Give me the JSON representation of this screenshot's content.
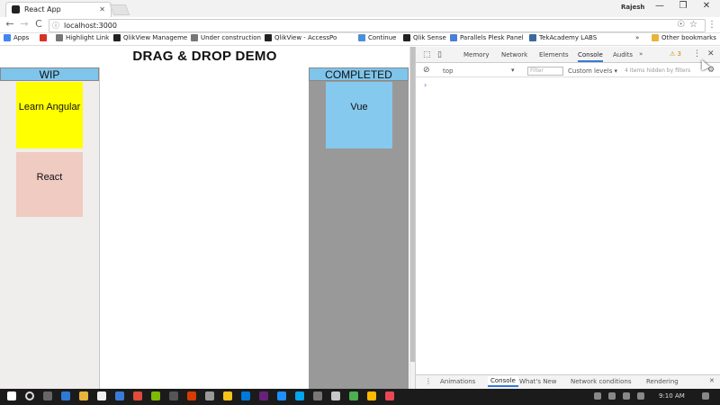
{
  "browser": {
    "tab_title": "React App",
    "user_name": "Rajesh",
    "url": "localhost:3000",
    "controls": {
      "minimize": "—",
      "maximize": "❐",
      "close": "✕"
    },
    "nav": {
      "back": "←",
      "forward": "→",
      "reload": "C"
    },
    "omnibox_icon": "ⓘ",
    "omnibox_right": {
      "zoom": "☉",
      "star": "☆",
      "menu": "⋮"
    }
  },
  "bookmarks": {
    "items": [
      {
        "label": "Apps",
        "icon": "apps-grid-icon",
        "color": "#4285f4"
      },
      {
        "label": "",
        "icon": "gmail-icon",
        "color": "#d93025"
      },
      {
        "label": "Highlight Link",
        "icon": "page-icon",
        "color": "#777777"
      },
      {
        "label": "QlikView Manageme",
        "icon": "qlik-icon",
        "color": "#222222"
      },
      {
        "label": "Under construction",
        "icon": "page-icon",
        "color": "#777777"
      },
      {
        "label": "QlikView - AccessPo",
        "icon": "qlik-icon",
        "color": "#222222"
      },
      {
        "label": "Continue",
        "icon": "folder-icon",
        "color": "#4a90d9"
      },
      {
        "label": "Qlik Sense",
        "icon": "qlik-icon",
        "color": "#222222"
      },
      {
        "label": "Parallels Plesk Panel",
        "icon": "plesk-icon",
        "color": "#4a7fd4"
      },
      {
        "label": "TekAcademy LABS",
        "icon": "tek-icon",
        "color": "#3a6a9a"
      }
    ],
    "overflow": "»",
    "other": "Other bookmarks"
  },
  "app": {
    "heading": "DRAG & DROP DEMO",
    "wip": {
      "title": "WIP",
      "cards": [
        {
          "label": "Learn Angular",
          "color": "#ffff00"
        },
        {
          "label": "React",
          "color": "#efcbc2"
        }
      ]
    },
    "completed": {
      "title": "COMPLETED",
      "cards": [
        {
          "label": "Vue",
          "color": "#86c9ee"
        }
      ]
    }
  },
  "devtools": {
    "tabs": [
      "Memory",
      "Network",
      "Elements",
      "Console",
      "Audits"
    ],
    "active_tab": "Console",
    "overflow": "»",
    "warning_count": "3",
    "context": "top",
    "filter_placeholder": "Filter",
    "levels": "Custom levels ▾",
    "hidden_note": "4 items hidden by filters",
    "prompt": "›",
    "drawer_tabs": [
      "Animations",
      "Console",
      "What's New",
      "Network conditions",
      "Rendering"
    ],
    "drawer_active": "Console",
    "drawer_close": "✕"
  },
  "taskbar": {
    "time": "9:10 AM"
  }
}
